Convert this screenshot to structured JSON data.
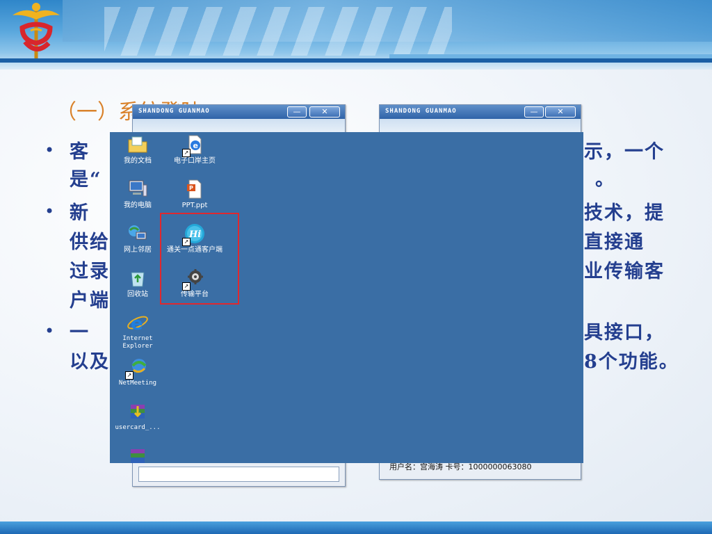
{
  "slide": {
    "heading": "（一）系统登陆",
    "bullets": [
      {
        "line1": "  客",
        "line1_right": "示，一个",
        "line2": "是“",
        "line2_right": "。"
      },
      {
        "line1": "  新",
        "line1_right": "技术，提",
        "line2": "供给",
        "line2_right": "直接通",
        "line3": "过录",
        "line3_right": "业传输客",
        "line4": "户端"
      },
      {
        "line1": "  一",
        "line1_right": "具接口，",
        "line2": "以及",
        "line2_right": "8个功能。"
      }
    ],
    "bullet_char": "•"
  },
  "windows": {
    "left": {
      "brand": "SHANDONG GUANMAO",
      "min": "—",
      "close": "✕"
    },
    "right": {
      "brand": "SHANDONG GUANMAO",
      "min": "—",
      "close": "✕",
      "status": "用户名：宫海涛  卡号：1000000063080"
    }
  },
  "desktop": {
    "icons": [
      {
        "name": "my-documents",
        "label": "我的文档"
      },
      {
        "name": "e-port-home",
        "label": "电子口岸主页"
      },
      {
        "name": "my-computer",
        "label": "我的电脑"
      },
      {
        "name": "ppt-file",
        "label": "PPT.ppt"
      },
      {
        "name": "network-places",
        "label": "网上邻居"
      },
      {
        "name": "tongguan-client",
        "label": "通关一点通客户端"
      },
      {
        "name": "recycle-bin",
        "label": "回收站"
      },
      {
        "name": "transfer-platform",
        "label": "传输平台"
      },
      {
        "name": "internet-explorer",
        "label": "Internet Explorer"
      },
      {
        "name": "netmeeting",
        "label": "NetMeeting"
      },
      {
        "name": "usercard",
        "label": "usercard_..."
      }
    ]
  },
  "colors": {
    "desktop": "#3a6ea5",
    "heading": "#d9822b",
    "text": "#243f8f",
    "highlight": "#e0282e"
  }
}
